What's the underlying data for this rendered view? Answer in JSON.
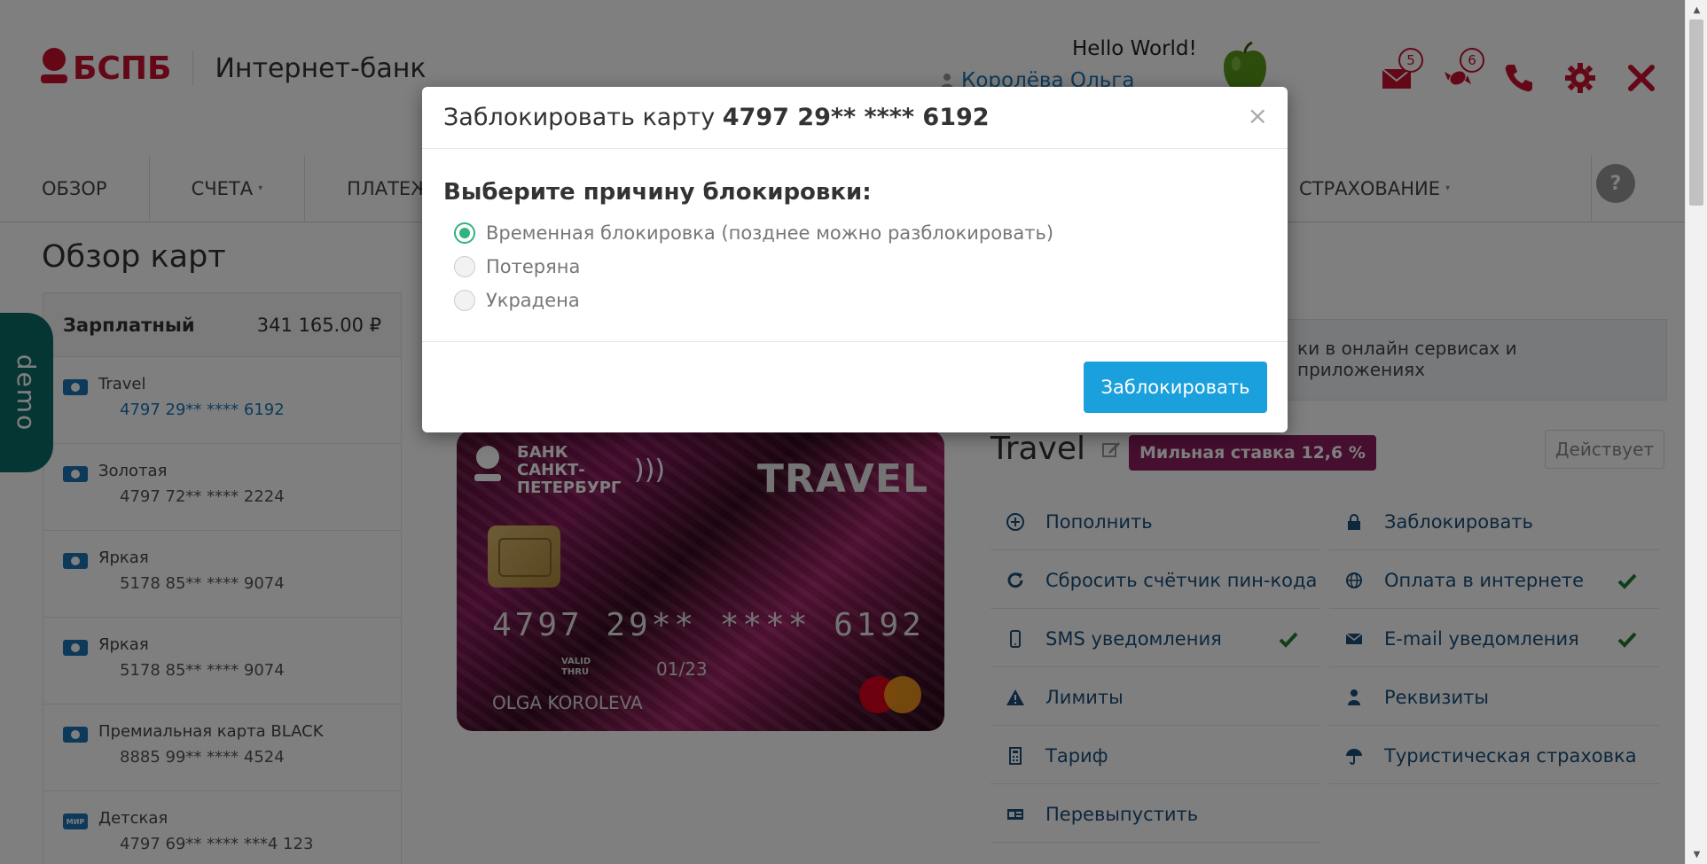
{
  "header": {
    "logo_text": "БСПБ",
    "logo_sub": "Интернет-банк",
    "hello": "Hello World!",
    "user_name": "Королёва Ольга",
    "icons": [
      {
        "name": "mail-icon",
        "badge": "5"
      },
      {
        "name": "candy-icon",
        "badge": "6"
      },
      {
        "name": "phone-icon",
        "badge": ""
      },
      {
        "name": "gear-icon",
        "badge": ""
      },
      {
        "name": "close-icon",
        "badge": ""
      }
    ]
  },
  "colors": {
    "brand": "#c8102e",
    "link": "#1a74b5",
    "accent_green": "#2fb37f",
    "button_blue": "#1aa0dc",
    "mile_badge": "#8c1c5e",
    "demo_tab": "#0b6d67"
  },
  "nav": {
    "items": [
      {
        "label": "ОБЗОР",
        "caret": ""
      },
      {
        "label": "СЧЕТА",
        "caret": "▾"
      },
      {
        "label": "ПЛАТЕЖ",
        "caret": ""
      }
    ],
    "right_item": {
      "label": "СТРАХОВАНИЕ",
      "caret": "▾"
    },
    "help": "?"
  },
  "page": {
    "title": "Обзор карт",
    "demo": "demo"
  },
  "sidebar": {
    "account_name": "Зарплатный",
    "account_sum": "341 165.00 ₽",
    "cards": [
      {
        "title": "Travel",
        "number": "4797 29** **** 6192",
        "icon": "card-icon"
      },
      {
        "title": "Золотая",
        "number": "4797 72** **** 2224",
        "icon": "card-icon"
      },
      {
        "title": "Яркая",
        "number": "5178 85** **** 9074",
        "icon": "card-icon"
      },
      {
        "title": "Яркая",
        "number": "5178 85** **** 9074",
        "icon": "card-icon"
      },
      {
        "title": "Премиальная карта BLACK",
        "number": "8885 99** **** 4524",
        "icon": "card-icon"
      },
      {
        "title": "Детская",
        "number": "4797 69** **** ***4 123",
        "icon": "mir-icon",
        "icon_text": "МИР"
      }
    ]
  },
  "info_strip": "ки в онлайн сервисах и приложениях",
  "card_visual": {
    "bank_line1": "БАНК",
    "bank_line2": "САНКТ-",
    "bank_line3": "ПЕТЕРБУРГ",
    "brand": "TRAVEL",
    "pan": "4797 29** **** 6192",
    "valid_line1": "VALID",
    "valid_line2": "THRU",
    "exp": "01/23",
    "holder": "OLGA KOROLEVA"
  },
  "card_detail": {
    "title": "Travel",
    "mile_badge": "Мильная ставка 12,6 %",
    "status": "Действует",
    "actions": [
      {
        "label": "Пополнить",
        "icon": "plus-circle-icon",
        "check": false
      },
      {
        "label": "Заблокировать",
        "icon": "lock-icon",
        "check": false
      },
      {
        "label": "Сбросить счётчик пин-кода",
        "icon": "refresh-icon",
        "check": false
      },
      {
        "label": "Оплата в интернете",
        "icon": "globe-icon",
        "check": true
      },
      {
        "label": "SMS уведомления",
        "icon": "mobile-icon",
        "check": true
      },
      {
        "label": "E-mail уведомления",
        "icon": "envelope-icon",
        "check": true
      },
      {
        "label": "Лимиты",
        "icon": "warning-icon",
        "check": false
      },
      {
        "label": "Реквизиты",
        "icon": "person-icon",
        "check": false
      },
      {
        "label": "Тариф",
        "icon": "calculator-icon",
        "check": false
      },
      {
        "label": "Туристическая страховка",
        "icon": "umbrella-icon",
        "check": false
      },
      {
        "label": "Перевыпустить",
        "icon": "id-card-icon",
        "check": false
      }
    ]
  },
  "modal": {
    "title_prefix": "Заблокировать карту ",
    "title_card": "4797 29** **** 6192",
    "close": "×",
    "question": "Выберите причину блокировки:",
    "options": [
      {
        "label": "Временная блокировка (позднее можно разблокировать)",
        "checked": true
      },
      {
        "label": "Потеряна",
        "checked": false
      },
      {
        "label": "Украдена",
        "checked": false
      }
    ],
    "submit": "Заблокировать"
  }
}
